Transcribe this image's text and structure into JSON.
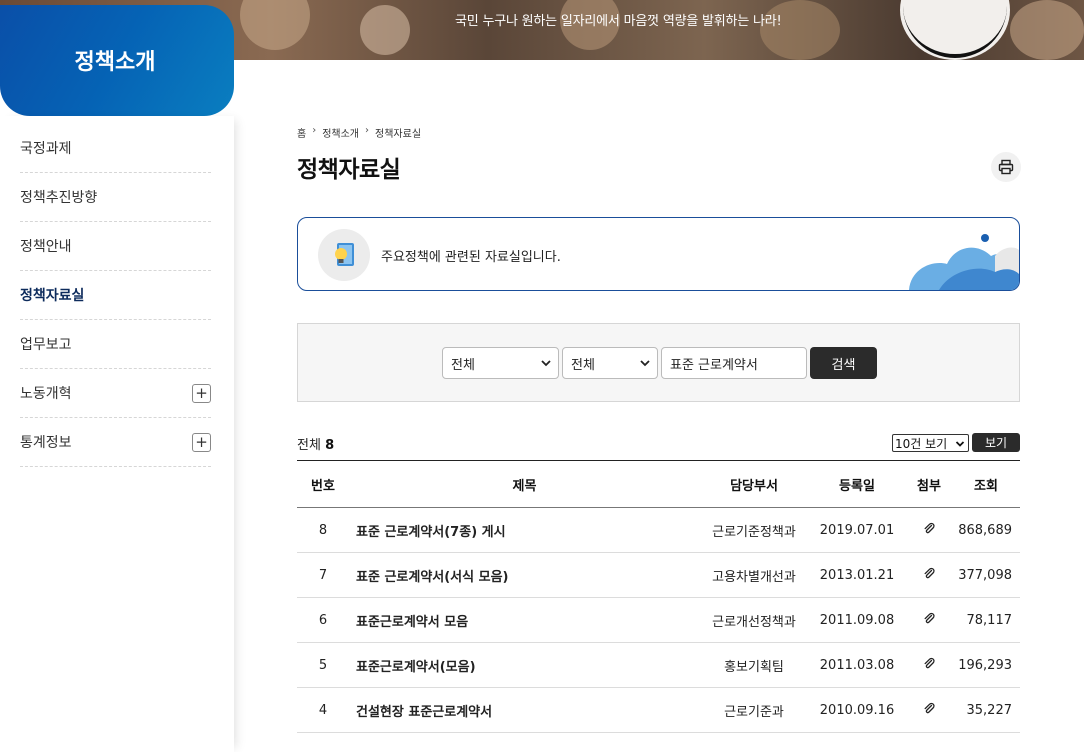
{
  "banner": {
    "slogan": "국민 누구나 원하는 일자리에서 마음껏 역량을 발휘하는 나라!"
  },
  "sidebar": {
    "title": "정책소개",
    "items": [
      {
        "label": "국정과제",
        "active": false,
        "expandable": false
      },
      {
        "label": "정책추진방향",
        "active": false,
        "expandable": false
      },
      {
        "label": "정책안내",
        "active": false,
        "expandable": false
      },
      {
        "label": "정책자료실",
        "active": true,
        "expandable": false
      },
      {
        "label": "업무보고",
        "active": false,
        "expandable": false
      },
      {
        "label": "노동개혁",
        "active": false,
        "expandable": true,
        "toggle": "+"
      },
      {
        "label": "통계정보",
        "active": false,
        "expandable": true,
        "toggle": "+"
      }
    ]
  },
  "breadcrumb": {
    "home": "홈",
    "level1": "정책소개",
    "level2": "정책자료실",
    "separator": "›"
  },
  "page": {
    "title": "정책자료실",
    "print_icon": "printer-icon"
  },
  "intro": {
    "text": "주요정책에 관련된 자료실입니다.",
    "icon": "book-lightbulb-icon"
  },
  "search": {
    "select1": "전체",
    "select2": "전체",
    "query": "표준 근로계약서",
    "button": "검색"
  },
  "list_meta": {
    "total_label": "전체",
    "total_count": "8",
    "page_size": "10건 보기",
    "view_button": "보기"
  },
  "table": {
    "headers": {
      "num": "번호",
      "title": "제목",
      "dept": "담당부서",
      "date": "등록일",
      "attach": "첨부",
      "views": "조회"
    },
    "rows": [
      {
        "num": "8",
        "title": "표준 근로계약서(7종) 게시",
        "dept": "근로기준정책과",
        "date": "2019.07.01",
        "views": "868,689"
      },
      {
        "num": "7",
        "title": "표준 근로계약서(서식 모음)",
        "dept": "고용차별개선과",
        "date": "2013.01.21",
        "views": "377,098"
      },
      {
        "num": "6",
        "title": "표준근로계약서 모음",
        "dept": "근로개선정책과",
        "date": "2011.09.08",
        "views": "78,117"
      },
      {
        "num": "5",
        "title": "표준근로계약서(모음)",
        "dept": "홍보기획팀",
        "date": "2011.03.08",
        "views": "196,293"
      },
      {
        "num": "4",
        "title": "건설현장 표준근로계약서",
        "dept": "근로기준과",
        "date": "2010.09.16",
        "views": "35,227"
      }
    ]
  },
  "colors": {
    "brand_blue": "#0563b5",
    "active_menu": "#0d2b5c",
    "dark_button": "#2b2b2b"
  }
}
